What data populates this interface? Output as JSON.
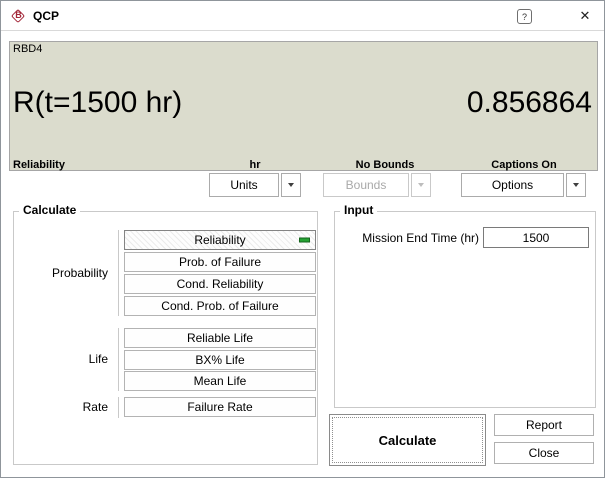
{
  "window": {
    "title": "QCP",
    "logo_letter": "B",
    "help_icon": "?",
    "close_icon": "✕"
  },
  "results": {
    "source_label": "RBD4",
    "expression": "R(t=1500 hr)",
    "value": "0.856864",
    "captions": {
      "metric": "Reliability",
      "units": "hr",
      "bounds": "No Bounds",
      "options": "Captions On"
    }
  },
  "toolbar": {
    "units": {
      "label": "Units",
      "enabled": true
    },
    "bounds": {
      "label": "Bounds",
      "enabled": false
    },
    "options": {
      "label": "Options",
      "enabled": true
    }
  },
  "calculate_group": {
    "title": "Calculate",
    "sections": [
      {
        "label": "Probability",
        "buttons": [
          "Reliability",
          "Prob. of Failure",
          "Cond. Reliability",
          "Cond. Prob. of Failure"
        ],
        "selected_index": 0
      },
      {
        "label": "Life",
        "buttons": [
          "Reliable Life",
          "BX% Life",
          "Mean Life"
        ]
      },
      {
        "label": "Rate",
        "buttons": [
          "Failure Rate"
        ]
      }
    ]
  },
  "input_group": {
    "title": "Input",
    "field_label": "Mission End Time (hr)",
    "field_value": "1500"
  },
  "actions": {
    "calculate": "Calculate",
    "report": "Report",
    "close": "Close"
  },
  "colors": {
    "results_panel_bg": "#dbdccd",
    "selected_indicator": "#25a233",
    "logo_red": "#a32638"
  }
}
